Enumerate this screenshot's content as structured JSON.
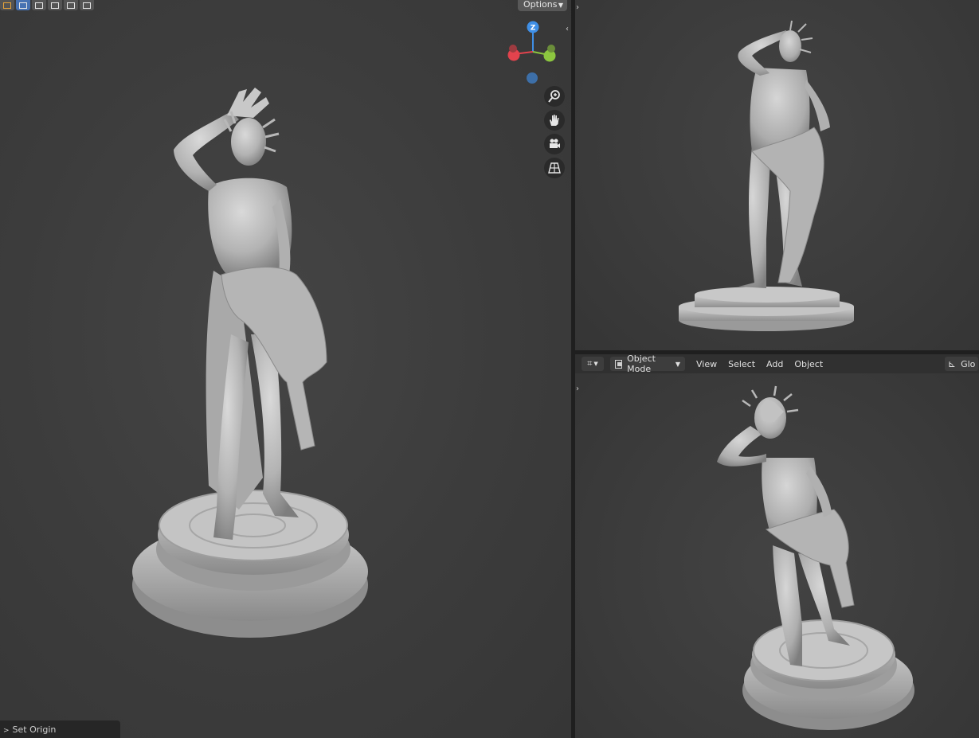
{
  "toolbar": {
    "select_modes": [
      "new",
      "extend",
      "subtract",
      "difference",
      "intersect"
    ],
    "options_label": "Options"
  },
  "gizmo": {
    "z_label": "Z",
    "colors": {
      "x": "#e3434d",
      "y": "#8cc63f",
      "z": "#3f8fe6"
    }
  },
  "nav_icons": [
    "zoom-icon",
    "pan-hand-icon",
    "camera-icon",
    "perspective-grid-icon"
  ],
  "header": {
    "editor_type_icon": "transform-gizmo-icon",
    "mode_label": "Object Mode",
    "menus": [
      "View",
      "Select",
      "Add",
      "Object"
    ],
    "transform_orientation_label": "Glo"
  },
  "operator_panel": {
    "label": "Set Origin"
  },
  "colors": {
    "viewport_bg": "#3d3d3d",
    "header_bg": "#303030",
    "active_select": "#4772b3"
  }
}
